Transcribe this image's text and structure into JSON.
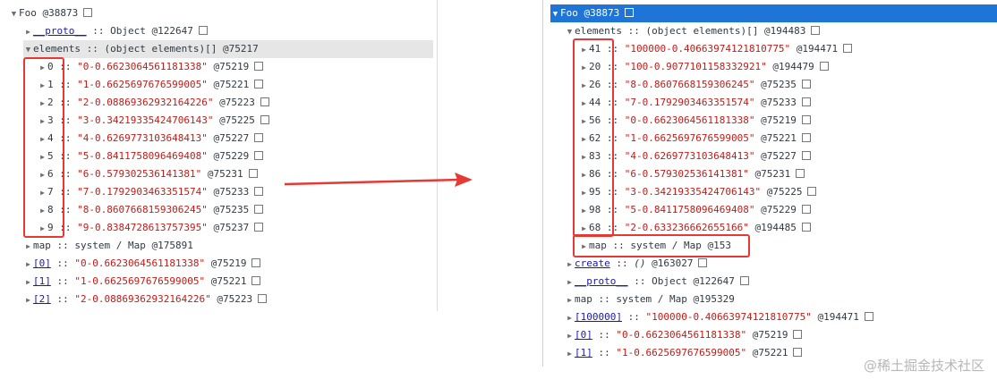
{
  "left": {
    "root": {
      "name": "Foo",
      "addr": "@38873"
    },
    "proto": {
      "key": "__proto__",
      "type": "Object",
      "addr": "@122647"
    },
    "elements": {
      "key": "elements",
      "type": "(object elements)[]",
      "addr": "@75217"
    },
    "items": [
      {
        "key": "0",
        "value": "\"0-0.6623064561181338\"",
        "addr": "@75219"
      },
      {
        "key": "1",
        "value": "\"1-0.6625697676599005\"",
        "addr": "@75221"
      },
      {
        "key": "2",
        "value": "\"2-0.08869362932164226\"",
        "addr": "@75223"
      },
      {
        "key": "3",
        "value": "\"3-0.34219335424706143\"",
        "addr": "@75225"
      },
      {
        "key": "4",
        "value": "\"4-0.6269773103648413\"",
        "addr": "@75227"
      },
      {
        "key": "5",
        "value": "\"5-0.8411758096469408\"",
        "addr": "@75229"
      },
      {
        "key": "6",
        "value": "\"6-0.579302536141381\"",
        "addr": "@75231"
      },
      {
        "key": "7",
        "value": "\"7-0.1792903463351574\"",
        "addr": "@75233"
      },
      {
        "key": "8",
        "value": "\"8-0.8607668159306245\"",
        "addr": "@75235"
      },
      {
        "key": "9",
        "value": "\"9-0.8384728613757395\"",
        "addr": "@75237"
      }
    ],
    "map": {
      "key": "map",
      "type": "system / Map",
      "addr": "@175891"
    },
    "indexed": [
      {
        "key": "[0]",
        "value": "\"0-0.6623064561181338\"",
        "addr": "@75219"
      },
      {
        "key": "[1]",
        "value": "\"1-0.6625697676599005\"",
        "addr": "@75221"
      },
      {
        "key": "[2]",
        "value": "\"2-0.08869362932164226\"",
        "addr": "@75223"
      }
    ]
  },
  "right": {
    "root": {
      "name": "Foo",
      "addr": "@38873"
    },
    "elements": {
      "key": "elements",
      "type": "(object elements)[]",
      "addr": "@194483"
    },
    "items": [
      {
        "key": "41",
        "value": "\"100000-0.40663974121810775\"",
        "addr": "@194471"
      },
      {
        "key": "20",
        "value": "\"100-0.9077101158332921\"",
        "addr": "@194479"
      },
      {
        "key": "26",
        "value": "\"8-0.8607668159306245\"",
        "addr": "@75235"
      },
      {
        "key": "44",
        "value": "\"7-0.1792903463351574\"",
        "addr": "@75233"
      },
      {
        "key": "56",
        "value": "\"0-0.6623064561181338\"",
        "addr": "@75219"
      },
      {
        "key": "62",
        "value": "\"1-0.6625697676599005\"",
        "addr": "@75221"
      },
      {
        "key": "83",
        "value": "\"4-0.6269773103648413\"",
        "addr": "@75227"
      },
      {
        "key": "86",
        "value": "\"6-0.579302536141381\"",
        "addr": "@75231"
      },
      {
        "key": "95",
        "value": "\"3-0.34219335424706143\"",
        "addr": "@75225"
      },
      {
        "key": "98",
        "value": "\"5-0.8411758096469408\"",
        "addr": "@75229"
      },
      {
        "key": "68",
        "value": "\"2-0.633236662655166\"",
        "addr": "@194485"
      }
    ],
    "map_inner": {
      "key": "map",
      "type": "system / Map",
      "addr": "@153"
    },
    "create": {
      "key": "create",
      "type": "()",
      "addr": "@163027"
    },
    "proto": {
      "key": "__proto__",
      "type": "Object",
      "addr": "@122647"
    },
    "map": {
      "key": "map",
      "type": "system / Map",
      "addr": "@195329"
    },
    "indexed": [
      {
        "key": "[100000]",
        "value": "\"100000-0.40663974121810775\"",
        "addr": "@194471"
      },
      {
        "key": "[0]",
        "value": "\"0-0.6623064561181338\"",
        "addr": "@75219"
      },
      {
        "key": "[1]",
        "value": "\"1-0.6625697676599005\"",
        "addr": "@75221"
      }
    ]
  },
  "watermark": "@稀土掘金技术社区",
  "colors": {
    "selection": "#1f74d8",
    "highlight_box": "#e53935",
    "string": "#c41a16",
    "key": "#881280"
  }
}
